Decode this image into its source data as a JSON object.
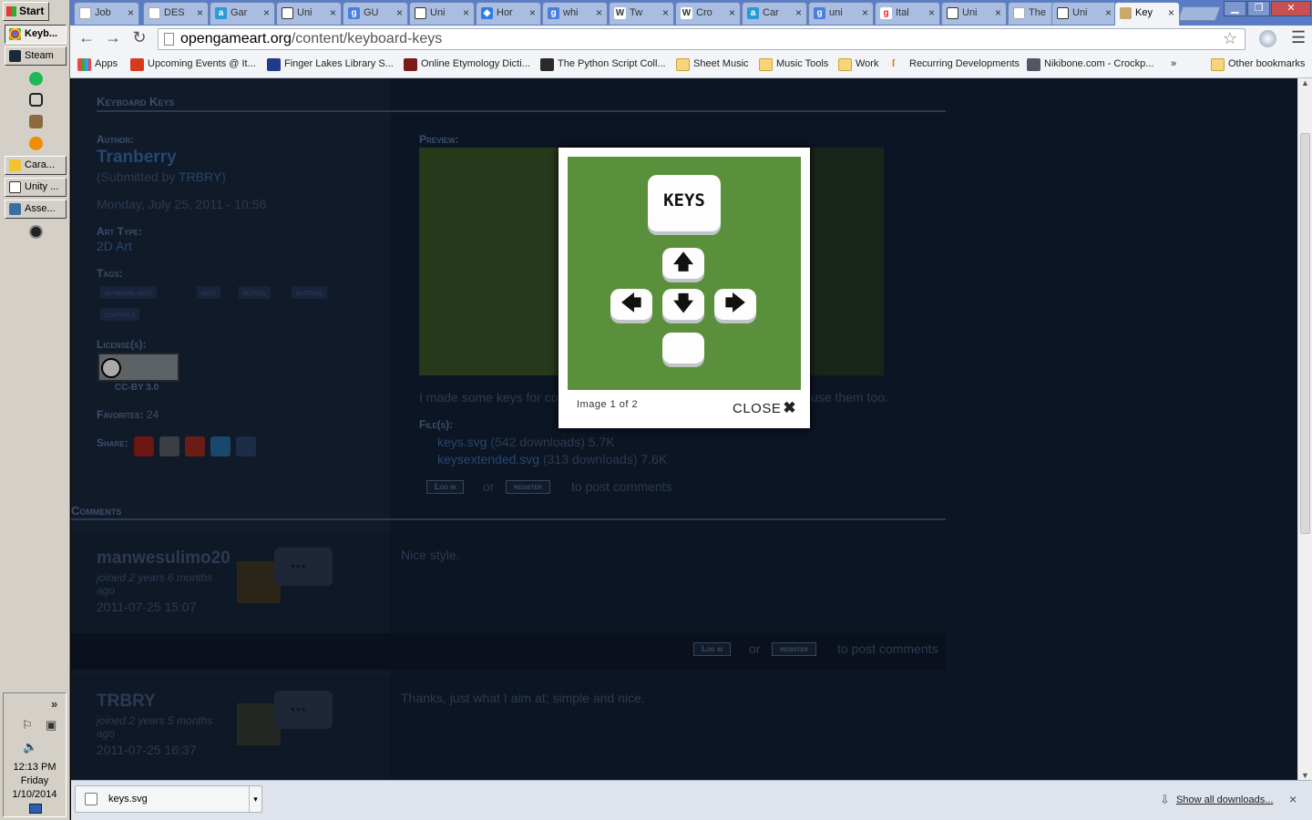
{
  "taskbar": {
    "start_label": "Start",
    "buttons": [
      "Keyb...",
      "Steam",
      "Cara...",
      "Unity ...",
      "Asse..."
    ],
    "tray_expand": "»",
    "clock_time": "12:13 PM",
    "clock_day": "Friday",
    "clock_date": "1/10/2014"
  },
  "browser": {
    "tabs": [
      "Job",
      "DES",
      "Gar",
      "Uni",
      "GU",
      "Uni",
      "Hor",
      "whi",
      "Tw",
      "Cro",
      "Car",
      "uni",
      "Ital",
      "Uni",
      "The",
      "Uni",
      "Key"
    ],
    "tab_close": "×",
    "url_domain": "opengameart.org",
    "url_path": "/content/keyboard-keys",
    "bookmarks": [
      "Apps",
      "Upcoming Events @ It...",
      "Finger Lakes Library S...",
      "Online Etymology Dicti...",
      "The Python Script Coll...",
      "Sheet Music",
      "Music Tools",
      "Work",
      "Recurring Developments",
      "Nikibone.com - Crockp..."
    ],
    "bookmarks_more": "»",
    "other_bookmarks": "Other bookmarks"
  },
  "page": {
    "title": "Keyboard Keys",
    "author_label": "Author:",
    "author": "Tranberry",
    "submitted_prefix": "(Submitted by ",
    "submitted_by": "TRBRY",
    "submitted_suffix": ")",
    "date": "Monday, July 25, 2011 - 10:56",
    "art_type_label": "Art Type:",
    "art_type": "2D Art",
    "tags_label": "Tags:",
    "tags": [
      "keyboard keys",
      "keys",
      "button",
      "buttons",
      "controls"
    ],
    "license_label": "License(s):",
    "license": "CC-BY 3.0",
    "favorites_label": "Favorites:",
    "favorites": "24",
    "share_label": "Share:",
    "preview_label": "Preview:",
    "description_left": "I made some keys for co",
    "description_right": "use them too.",
    "files_label": "File(s):",
    "files": [
      {
        "name": "keys.svg",
        "info": " (542 downloads) 5.7K"
      },
      {
        "name": "keysextended.svg",
        "info": " (313 downloads) 7.6K"
      }
    ],
    "login_label": "Log in",
    "or_label": "or",
    "register_label": "register",
    "post_comments": "to post comments",
    "comments_label": "Comments",
    "comments": [
      {
        "user": "manwesulimo20",
        "joined": "joined 2 years 6 months ago",
        "timestamp": "2011-07-25 15:07",
        "text": "Nice style."
      },
      {
        "user": "TRBRY",
        "joined": "joined 2 years 5 months ago",
        "timestamp": "2011-07-25 16:37",
        "text": "Thanks, just what I aim at; simple and nice."
      }
    ]
  },
  "lightbox": {
    "keys_label": "KEYS",
    "caption": "Image 1 of 2",
    "close_label": "CLOSE"
  },
  "downloads": {
    "file": "keys.svg",
    "show_all": "Show all downloads...",
    "close": "×"
  }
}
